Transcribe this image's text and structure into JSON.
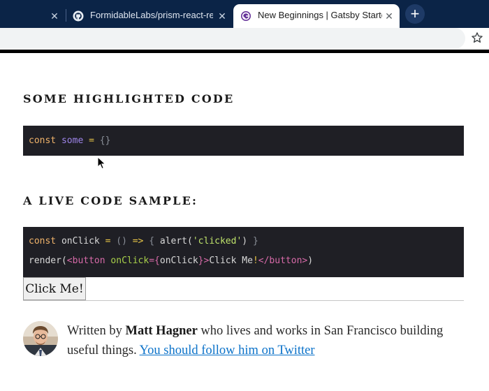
{
  "browser": {
    "tabs": [
      {
        "title": "",
        "active": false
      },
      {
        "title": "FormidableLabs/prism-react-re",
        "active": false,
        "icon": "github-icon"
      },
      {
        "title": "New Beginnings | Gatsby Starte",
        "active": true,
        "icon": "gatsby-icon"
      }
    ],
    "close_glyph": "✕",
    "new_tab_glyph": "+",
    "bookmark_icon": "star-icon"
  },
  "page": {
    "section1_heading": "SOME HIGHLIGHTED CODE",
    "code_sample_1": {
      "kw_const": "const",
      "var_name": "some",
      "op_eq": "=",
      "value": "{}"
    },
    "section2_heading": "A LIVE CODE SAMPLE:",
    "code_sample_2": {
      "line1": {
        "kw_const": "const",
        "name": "onClick",
        "op_eq": "=",
        "parens": "()",
        "arrow": "=>",
        "brace_open": "{",
        "call": "alert(",
        "str": "'clicked'",
        "call_close": ")",
        "brace_close": "}"
      },
      "line2": {
        "render": "render(",
        "tag_open": "<button",
        "attr": "onClick",
        "attr_eq": "=",
        "expr_open": "{",
        "expr": "onClick",
        "expr_close": "}",
        "tag_gt": ">",
        "text": "Click Me",
        "bang": "!",
        "tag_close": "</button>",
        "paren_close": ")"
      }
    },
    "demo_button_label": "Click Me!",
    "bio": {
      "prefix": "Written by ",
      "author": "Matt Hagner",
      "middle": " who lives and works in San Francisco building useful things. ",
      "link": "You should follow him on Twitter"
    }
  },
  "colors": {
    "tabbar": "#0b2447",
    "code_bg": "#1f1f25",
    "keyword": "#f0b36a",
    "variable": "#9d84e8",
    "operator": "#e8c547",
    "string": "#bfe36b",
    "tag": "#d76aa8",
    "attribute": "#a8d04a",
    "link": "#0b72c9"
  }
}
